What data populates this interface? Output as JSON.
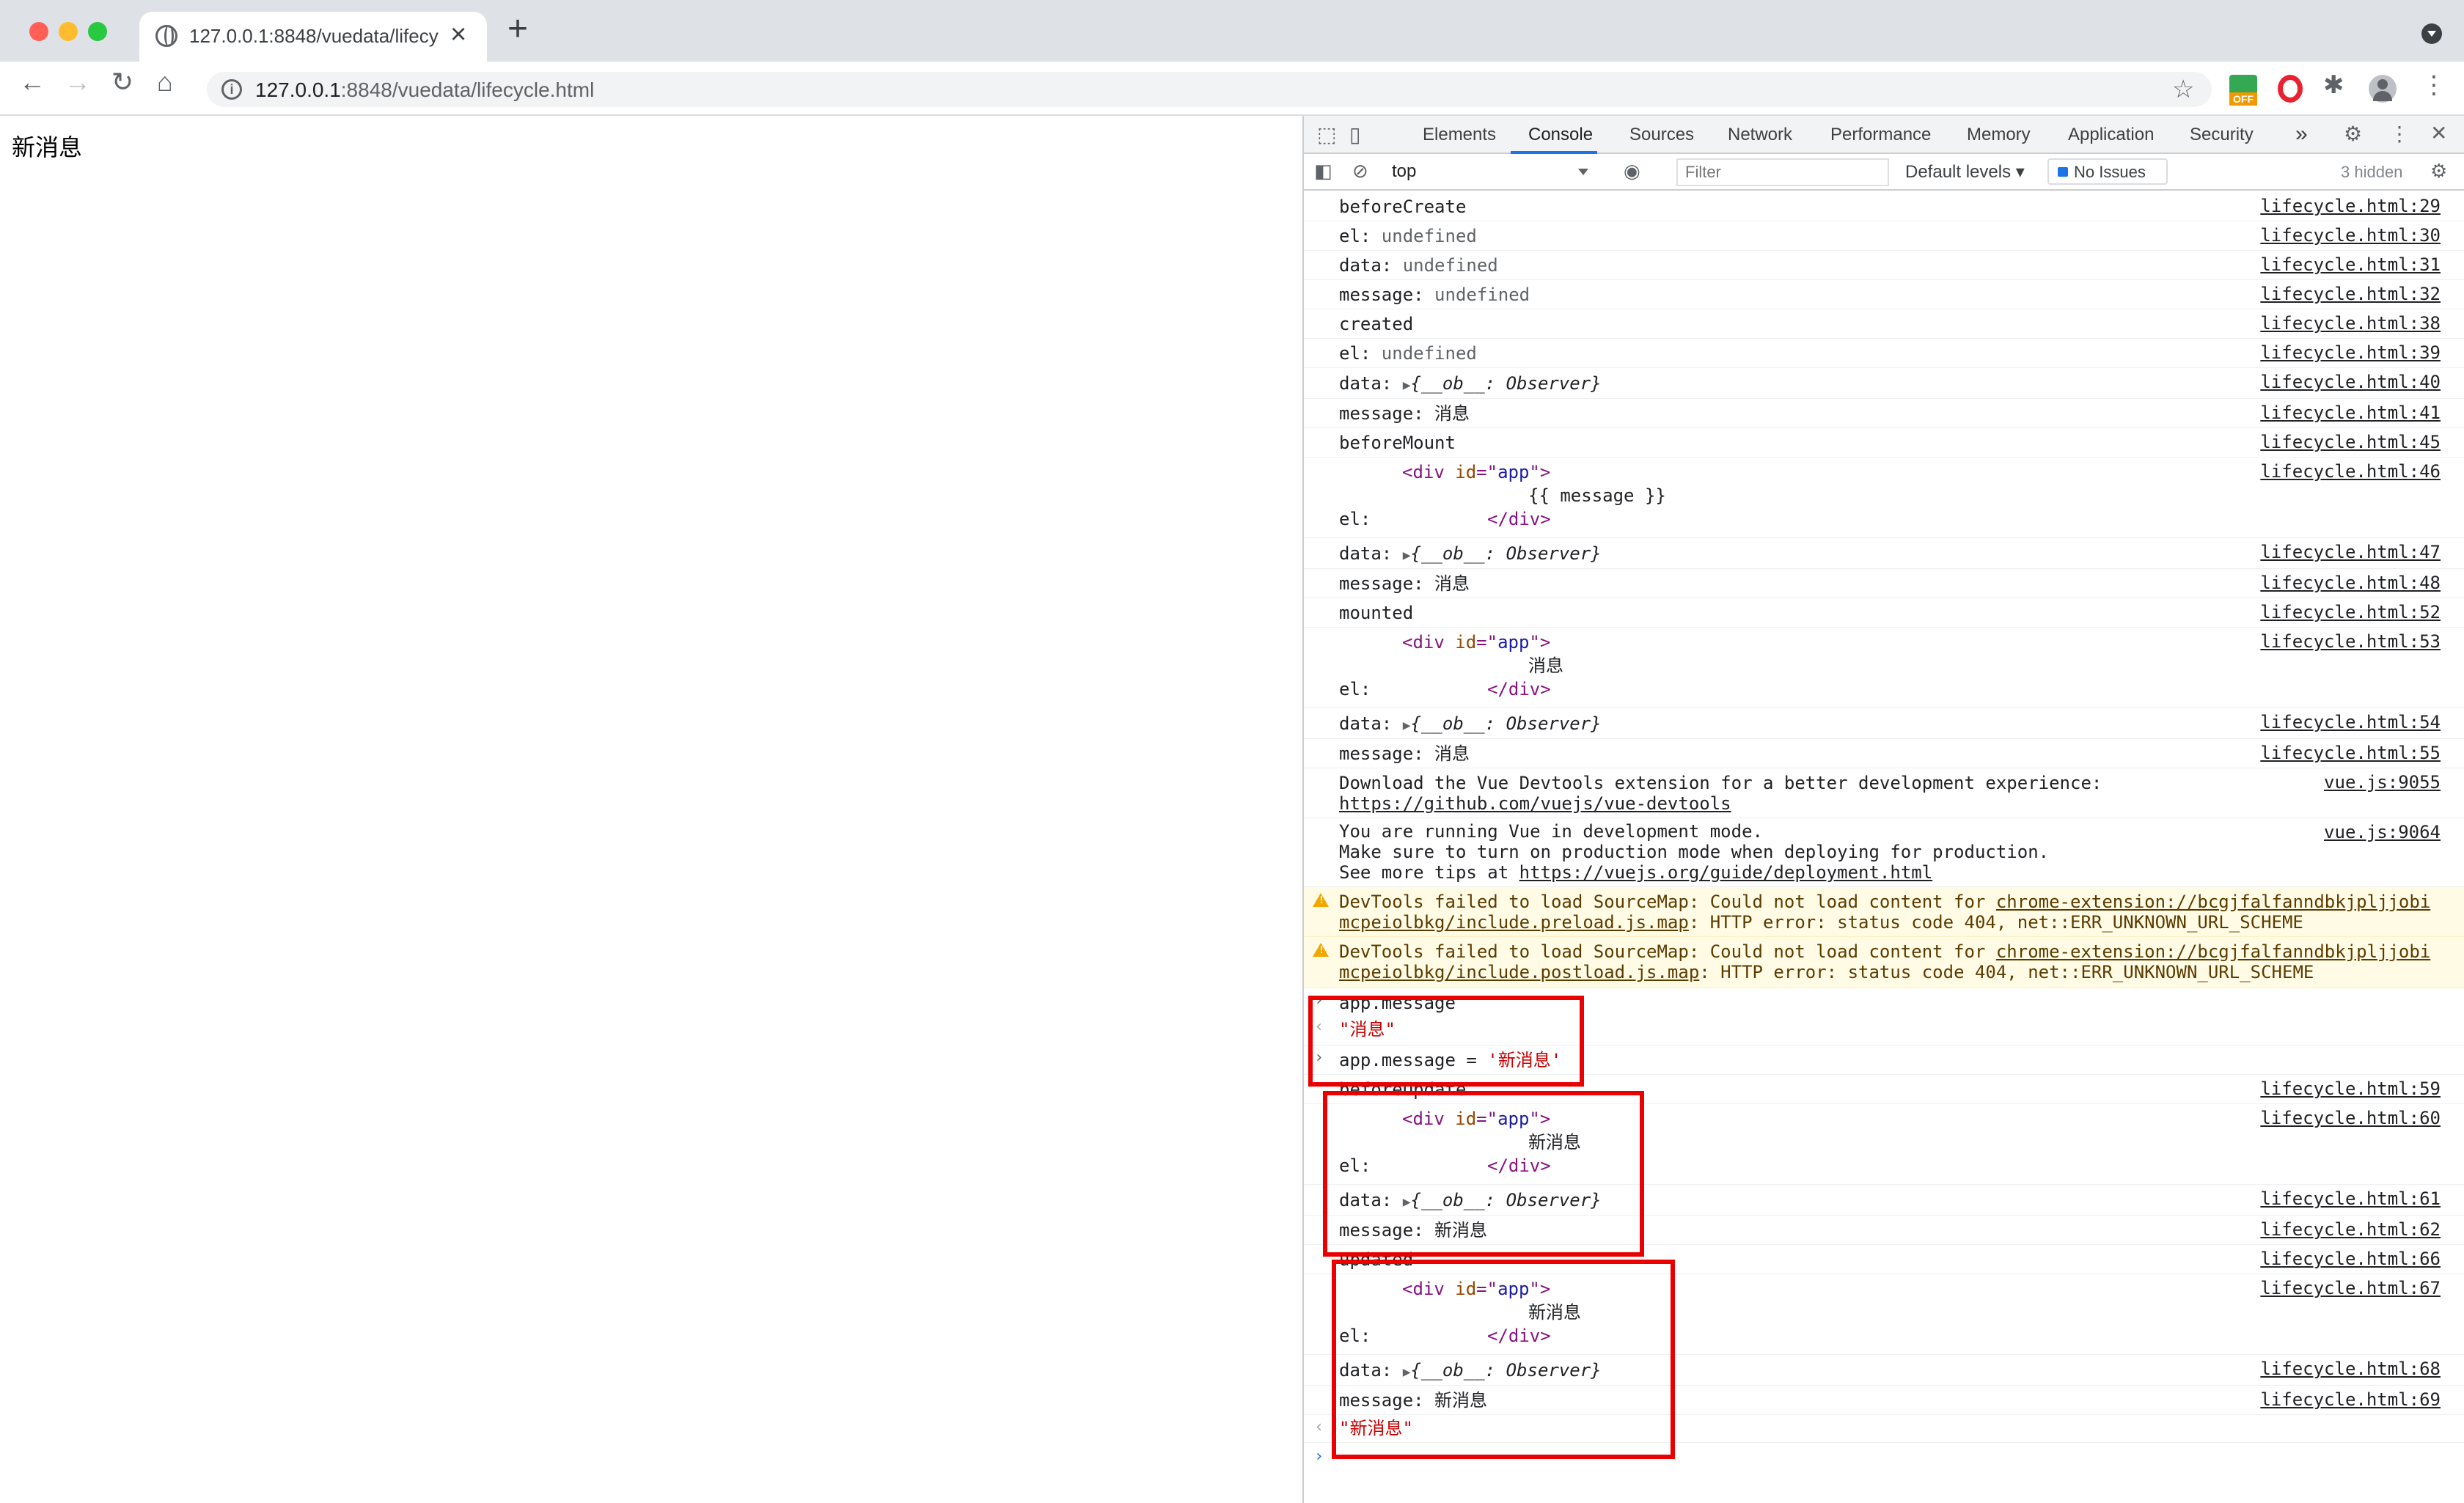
{
  "browser": {
    "tab_title": "127.0.0.1:8848/vuedata/lifecycle.html",
    "tab_close": "×",
    "new_tab": "+",
    "url_host": "127.0.0.1",
    "url_rest": ":8848/vuedata/lifecycle.html",
    "ext_off_badge": "OFF",
    "colors": {
      "titlebar": "#dee1e6",
      "close": "#ff5f57",
      "minimize": "#febc2e",
      "maximize": "#28c840"
    }
  },
  "page": {
    "message": "新消息"
  },
  "devtools": {
    "tabs": [
      "Elements",
      "Console",
      "Sources",
      "Network",
      "Performance",
      "Memory",
      "Application",
      "Security"
    ],
    "more_tabs": "»",
    "context": "top",
    "filter_placeholder": "Filter",
    "levels": "Default levels ▾",
    "issues": "No Issues",
    "hidden": "3 hidden"
  },
  "console": {
    "r1": {
      "text": "beforeCreate",
      "src": "lifecycle.html:29"
    },
    "r2": {
      "label": "el: ",
      "value": "undefined",
      "src": "lifecycle.html:30"
    },
    "r3": {
      "label": "data: ",
      "value": "undefined",
      "src": "lifecycle.html:31"
    },
    "r4": {
      "label": "message: ",
      "value": "undefined",
      "src": "lifecycle.html:32"
    },
    "r5": {
      "text": "created",
      "src": "lifecycle.html:38"
    },
    "r6": {
      "label": "el: ",
      "value": "undefined",
      "src": "lifecycle.html:39"
    },
    "r7": {
      "label": "data: ",
      "value": "{__ob__: Observer}",
      "src": "lifecycle.html:40"
    },
    "r8": {
      "label": "message: ",
      "value": "消息",
      "src": "lifecycle.html:41"
    },
    "r9": {
      "text": "beforeMount",
      "src": "lifecycle.html:45"
    },
    "r10": {
      "open": "<div id=\"app\">",
      "inner": "{{ message }}",
      "close": "</div>",
      "label": "el:",
      "src": "lifecycle.html:46"
    },
    "r11": {
      "label": "data: ",
      "value": "{__ob__: Observer}",
      "src": "lifecycle.html:47"
    },
    "r12": {
      "label": "message: ",
      "value": "消息",
      "src": "lifecycle.html:48"
    },
    "r13": {
      "text": "mounted",
      "src": "lifecycle.html:52"
    },
    "r14": {
      "open": "<div id=\"app\">",
      "inner": "消息",
      "close": "</div>",
      "label": "el:",
      "src": "lifecycle.html:53"
    },
    "r15": {
      "label": "data: ",
      "value": "{__ob__: Observer}",
      "src": "lifecycle.html:54"
    },
    "r16": {
      "label": "message: ",
      "value": "消息",
      "src": "lifecycle.html:55"
    },
    "r17": {
      "line1": "Download the Vue Devtools extension for a better development experience:",
      "link": "https://github.com/vuejs/vue-devtools",
      "src": "vue.js:9055"
    },
    "r18": {
      "line1": "You are running Vue in development mode.",
      "line2": "Make sure to turn on production mode when deploying for production.",
      "line3_prefix": "See more tips at ",
      "link": "https://vuejs.org/guide/deployment.html",
      "src": "vue.js:9064"
    },
    "w1": {
      "prefix": "DevTools failed to load SourceMap: Could not load content for ",
      "link1": "chrome-extension://bcgjfalfanndbkjpljjobi",
      "link2": "mcpeiolbkg/include.preload.js.map",
      "suffix": ": HTTP error: status code 404, net::ERR_UNKNOWN_URL_SCHEME"
    },
    "w2": {
      "prefix": "DevTools failed to load SourceMap: Could not load content for ",
      "link1": "chrome-extension://bcgjfalfanndbkjpljjobi",
      "link2": "mcpeiolbkg/include.postload.js.map",
      "suffix": ": HTTP error: status code 404, net::ERR_UNKNOWN_URL_SCHEME"
    },
    "c1": {
      "input": "app.message",
      "result": "\"消息\""
    },
    "c2": {
      "input_prefix": "app.message = ",
      "input_str": "'新消息'"
    },
    "r19": {
      "text": "beforeUpdate",
      "src": "lifecycle.html:59"
    },
    "r20": {
      "open": "<div id=\"app\">",
      "inner": "新消息",
      "close": "</div>",
      "label": "el:",
      "src": "lifecycle.html:60"
    },
    "r21": {
      "label": "data: ",
      "value": "{__ob__: Observer}",
      "src": "lifecycle.html:61"
    },
    "r22": {
      "label": "message: ",
      "value": "新消息",
      "src": "lifecycle.html:62"
    },
    "r23": {
      "text": "updated",
      "src": "lifecycle.html:66"
    },
    "r24": {
      "open": "<div id=\"app\">",
      "inner": "新消息",
      "close": "</div>",
      "label": "el:",
      "src": "lifecycle.html:67"
    },
    "r25": {
      "label": "data: ",
      "value": "{__ob__: Observer}",
      "src": "lifecycle.html:68"
    },
    "r26": {
      "label": "message: ",
      "value": "新消息",
      "src": "lifecycle.html:69"
    },
    "c3": {
      "result": "\"新消息\""
    },
    "prompt_symbol": "›",
    "result_symbol": "‹"
  }
}
